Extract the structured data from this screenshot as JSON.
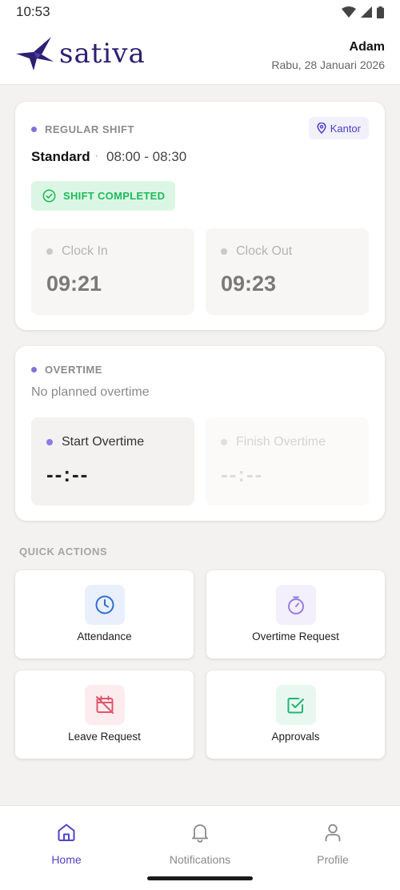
{
  "status_bar": {
    "time": "10:53"
  },
  "header": {
    "logo_text": "sativa",
    "user_name": "Adam",
    "date": "Rabu, 28 Januari 2026"
  },
  "shift": {
    "section_label": "REGULAR SHIFT",
    "location": "Kantor",
    "name": "Standard",
    "separator": "·",
    "hours": "08:00 - 08:30",
    "status": "SHIFT COMPLETED",
    "clock_in_label": "Clock In",
    "clock_in_value": "09:21",
    "clock_out_label": "Clock Out",
    "clock_out_value": "09:23"
  },
  "overtime": {
    "section_label": "OVERTIME",
    "note": "No planned overtime",
    "start_label": "Start Overtime",
    "start_value": "--:--",
    "finish_label": "Finish Overtime",
    "finish_value": "--:--"
  },
  "quick_actions": {
    "title": "QUICK ACTIONS",
    "items": [
      {
        "label": "Attendance",
        "icon": "clock-icon",
        "color": "#2f6fd6"
      },
      {
        "label": "Overtime Request",
        "icon": "stopwatch-icon",
        "color": "#9b7fe0"
      },
      {
        "label": "Leave Request",
        "icon": "calendar-off-icon",
        "color": "#e0566a"
      },
      {
        "label": "Approvals",
        "icon": "checkbox-icon",
        "color": "#22b573"
      }
    ]
  },
  "bottom_nav": {
    "items": [
      {
        "label": "Home",
        "icon": "home-icon",
        "active": true
      },
      {
        "label": "Notifications",
        "icon": "bell-icon",
        "active": false
      },
      {
        "label": "Profile",
        "icon": "person-icon",
        "active": false
      }
    ]
  },
  "colors": {
    "brand": "#2d1f73",
    "accent": "#4e44c8",
    "success": "#1fbb5b"
  }
}
